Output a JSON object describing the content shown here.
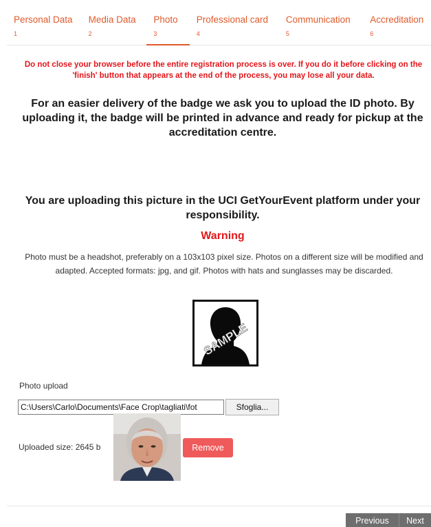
{
  "tabs": [
    {
      "label": "Personal Data",
      "num": "1"
    },
    {
      "label": "Media Data",
      "num": "2"
    },
    {
      "label": "Photo",
      "num": "3"
    },
    {
      "label": "Professional card",
      "num": "4"
    },
    {
      "label": "Communication",
      "num": "5"
    },
    {
      "label": "Accreditation",
      "num": "6"
    }
  ],
  "alert": "Do not close your browser before the entire registration process is over. If you do it before clicking on the 'finish' button that appears at the end of the process, you may lose all your data.",
  "intro": "For an easier delivery of the badge we ask you to upload the ID photo. By uploading it, the badge will be printed in advance and ready for pickup at the accreditation centre.",
  "responsibility": "You are uploading this picture in the UCI GetYourEvent platform under your responsibility.",
  "warning": {
    "title": "Warning",
    "text": "Photo must be a headshot, preferably on a 103x103 pixel size. Photos on a different size will be modified and adapted. Accepted formats: jpg, and gif. Photos with hats and sunglasses may be discarded."
  },
  "sample_label": "SAMPLE",
  "upload": {
    "label": "Photo upload",
    "file_value": "C:\\Users\\Carlo\\Documents\\Face Crop\\tagliati\\fot",
    "browse_label": "Sfoglia...",
    "uploaded_size": "Uploaded size: 2645 b",
    "remove_label": "Remove"
  },
  "nav": {
    "previous": "Previous",
    "next": "Next"
  },
  "colors": {
    "accent": "#e05a2b",
    "alert": "#e3161b",
    "remove": "#ef5a5a",
    "nav_bg": "#6e6e6e"
  }
}
